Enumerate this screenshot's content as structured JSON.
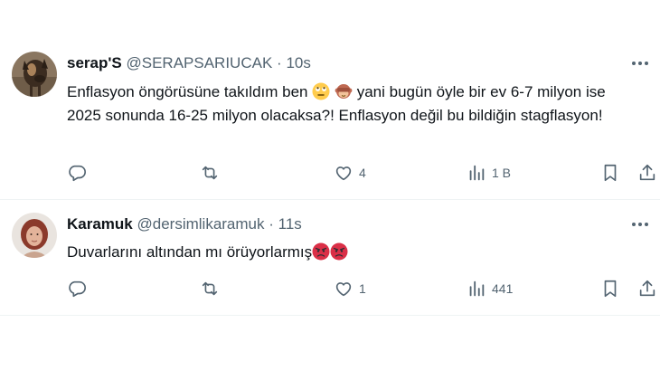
{
  "tweets": [
    {
      "name": "serap'S",
      "handle": "@SERAPSARIUCAK",
      "dot": "·",
      "time": "10s",
      "text_part1": "Enflasyon öngörüsüne takıldım ben",
      "text_part2": " yani bugün öyle bir ev 6-7 milyon ise 2025 sonunda 16-25 milyon olacaksa?! Enflasyon değil bu bildiğin stagflasyon!",
      "emojis": [
        "face-with-rolling-eyes-emoji",
        "see-no-evil-monkey-emoji"
      ],
      "actions": {
        "reply": "",
        "retweet": "",
        "like": "4",
        "views": "1 B"
      },
      "avatar": "dog-avatar"
    },
    {
      "name": "Karamuk",
      "handle": "@dersimlikaramuk",
      "dot": "·",
      "time": "11s",
      "text_part1": "Duvarlarını altından mı örüyorlarmış",
      "text_part2": "",
      "emojis": [
        "pouting-face-emoji",
        "pouting-face-emoji"
      ],
      "actions": {
        "reply": "",
        "retweet": "",
        "like": "1",
        "views": "441"
      },
      "avatar": "woman-avatar"
    }
  ],
  "colors": {
    "text": "#0f1419",
    "secondary": "#536471",
    "divider": "#eff3f4"
  },
  "icons": [
    "reply-icon",
    "retweet-icon",
    "like-icon",
    "views-icon",
    "bookmark-icon",
    "share-icon",
    "more-icon"
  ]
}
